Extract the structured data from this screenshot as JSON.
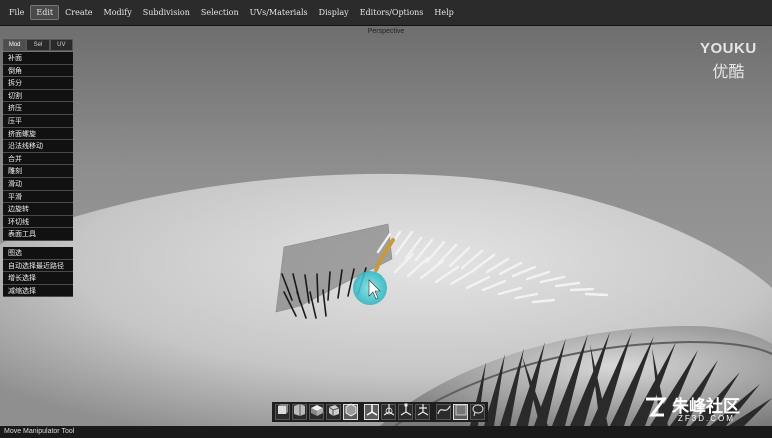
{
  "menubar": {
    "items": [
      {
        "label": "File"
      },
      {
        "label": "Edit",
        "active": true
      },
      {
        "label": "Create"
      },
      {
        "label": "Modify"
      },
      {
        "label": "Subdivision"
      },
      {
        "label": "Selection"
      },
      {
        "label": "UVs/Materials"
      },
      {
        "label": "Display"
      },
      {
        "label": "Editors/Options"
      },
      {
        "label": "Help"
      }
    ]
  },
  "viewport": {
    "title": "Perspective"
  },
  "panel": {
    "tabs": [
      {
        "label": "Mod",
        "active": true
      },
      {
        "label": "Sel"
      },
      {
        "label": "UV"
      }
    ],
    "tools": [
      "补面",
      "倒角",
      "拆分",
      "切割",
      "挤压",
      "压平",
      "挤面螺旋",
      "沿法线移动",
      "合并",
      "雕刻",
      "滑动",
      "平滑",
      "边旋转",
      "环切线",
      "表面工具"
    ],
    "selection_tools": [
      "图选",
      "自动选择最近路径",
      "增长选择",
      "减缩选择"
    ]
  },
  "toolbar": {
    "buttons": [
      {
        "icon": "cube-front-icon"
      },
      {
        "icon": "cube-side-icon"
      },
      {
        "icon": "cube-top-icon"
      },
      {
        "icon": "cube-persp-icon"
      },
      {
        "icon": "hexagon-icon",
        "active": true
      },
      {
        "sep": true
      },
      {
        "icon": "move-axis-icon",
        "active": true
      },
      {
        "icon": "rotate-axis-icon"
      },
      {
        "icon": "scale-axis-icon"
      },
      {
        "icon": "universal-axis-icon"
      },
      {
        "sep": true
      },
      {
        "icon": "curve-icon"
      },
      {
        "icon": "square-icon",
        "active": true
      },
      {
        "icon": "lasso-icon"
      }
    ]
  },
  "status": {
    "text": "Move Manipulator Tool"
  },
  "watermarks": {
    "youku_en": "YOUKU",
    "youku_cn": "优酷",
    "site_cn": "朱峰社区",
    "site_en": "ZF3D.COM"
  },
  "colors": {
    "menubar": "#2b2b2b",
    "panel_button": "#111111",
    "cursor_highlight": "#35c6cf"
  }
}
